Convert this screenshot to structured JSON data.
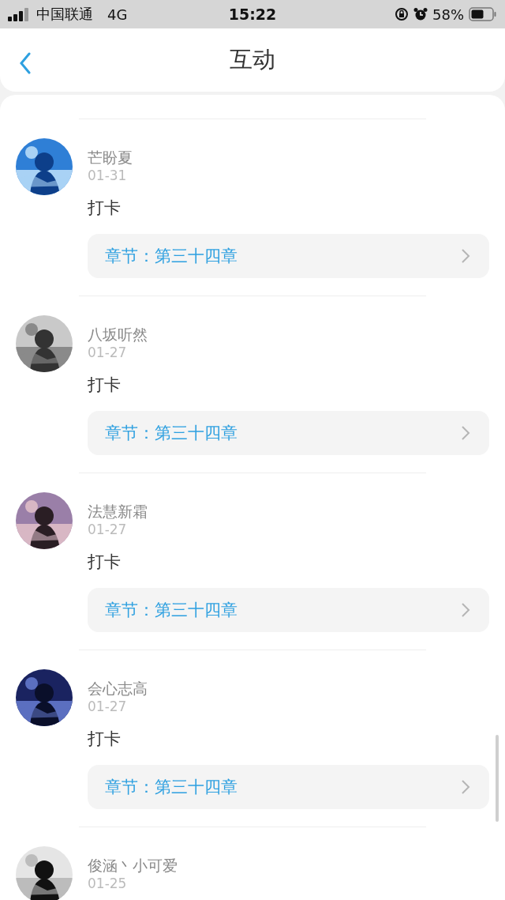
{
  "status_bar": {
    "carrier": "中国联通",
    "network": "4G",
    "time": "15:22",
    "battery": "58%"
  },
  "header": {
    "title": "互动"
  },
  "posts": [
    {
      "name": "芒盼夏",
      "date": "01-31",
      "content": "打卡",
      "chapter": "章节：第三十四章"
    },
    {
      "name": "八坂听然",
      "date": "01-27",
      "content": "打卡",
      "chapter": "章节：第三十四章"
    },
    {
      "name": "法慧新霜",
      "date": "01-27",
      "content": "打卡",
      "chapter": "章节：第三十四章"
    },
    {
      "name": "会心志高",
      "date": "01-27",
      "content": "打卡",
      "chapter": "章节：第三十四章"
    },
    {
      "name": "俊涵丶小可爱",
      "date": "01-25"
    }
  ]
}
